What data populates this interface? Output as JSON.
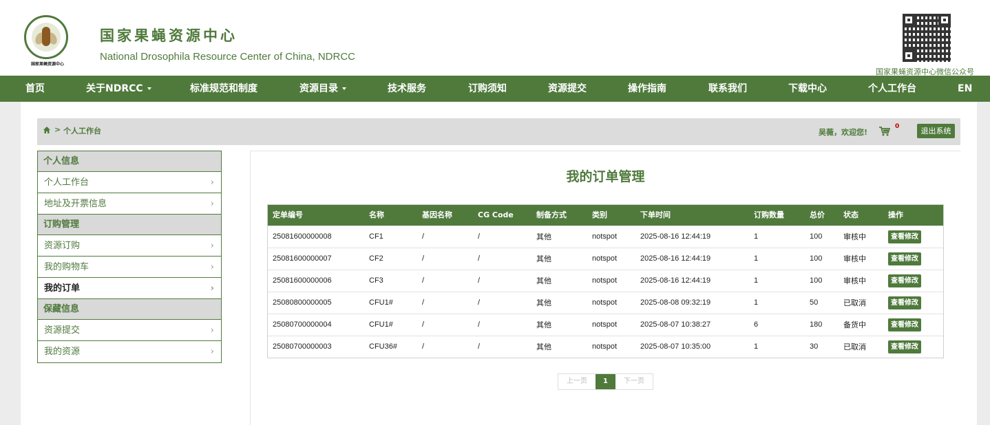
{
  "header": {
    "logo_text": "国家果蝇资源中心",
    "title": "国家果蝇资源中心",
    "subtitle": "National Drosophila Resource Center of China, NDRCC",
    "qr_caption": "国家果蝇资源中心微信公众号"
  },
  "nav": {
    "items": [
      "首页",
      "关于NDRCC",
      "标准规范和制度",
      "资源目录",
      "技术服务",
      "订购须知",
      "资源提交",
      "操作指南",
      "联系我们",
      "下载中心",
      "个人工作台",
      "EN"
    ]
  },
  "breadcrumb": {
    "separator": ">",
    "current": "个人工作台"
  },
  "user": {
    "welcome": "吴薇，欢迎您!",
    "cart_count": "0",
    "logout": "退出系统"
  },
  "sidebar": {
    "sections": [
      {
        "title": "个人信息",
        "items": [
          "个人工作台",
          "地址及开票信息"
        ]
      },
      {
        "title": "订购管理",
        "items": [
          "资源订购",
          "我的购物车",
          "我的订单"
        ]
      },
      {
        "title": "保藏信息",
        "items": [
          "资源提交",
          "我的资源"
        ]
      }
    ],
    "active_item": "我的订单"
  },
  "main": {
    "heading": "我的订单管理",
    "columns": [
      "定单编号",
      "名称",
      "基因名称",
      "CG Code",
      "制备方式",
      "类别",
      "下单时间",
      "订购数量",
      "总价",
      "状态",
      "操作"
    ],
    "rows": [
      [
        "25081600000008",
        "CF1",
        "/",
        "/",
        "其他",
        "notspot",
        "2025-08-16 12:44:19",
        "1",
        "100",
        "审核中",
        "查看修改"
      ],
      [
        "25081600000007",
        "CF2",
        "/",
        "/",
        "其他",
        "notspot",
        "2025-08-16 12:44:19",
        "1",
        "100",
        "审核中",
        "查看修改"
      ],
      [
        "25081600000006",
        "CF3",
        "/",
        "/",
        "其他",
        "notspot",
        "2025-08-16 12:44:19",
        "1",
        "100",
        "审核中",
        "查看修改"
      ],
      [
        "25080800000005",
        "CFU1#",
        "/",
        "/",
        "其他",
        "notspot",
        "2025-08-08 09:32:19",
        "1",
        "50",
        "已取消",
        "查看修改"
      ],
      [
        "25080700000004",
        "CFU1#",
        "/",
        "/",
        "其他",
        "notspot",
        "2025-08-07 10:38:27",
        "6",
        "180",
        "备货中",
        "查看修改"
      ],
      [
        "25080700000003",
        "CFU36#",
        "/",
        "/",
        "其他",
        "notspot",
        "2025-08-07 10:35:00",
        "1",
        "30",
        "已取消",
        "查看修改"
      ]
    ],
    "pager": {
      "prev": "上一页",
      "current": "1",
      "next": "下一页"
    }
  },
  "colors": {
    "brand": "#4f7a3c",
    "alert": "#c00000"
  }
}
